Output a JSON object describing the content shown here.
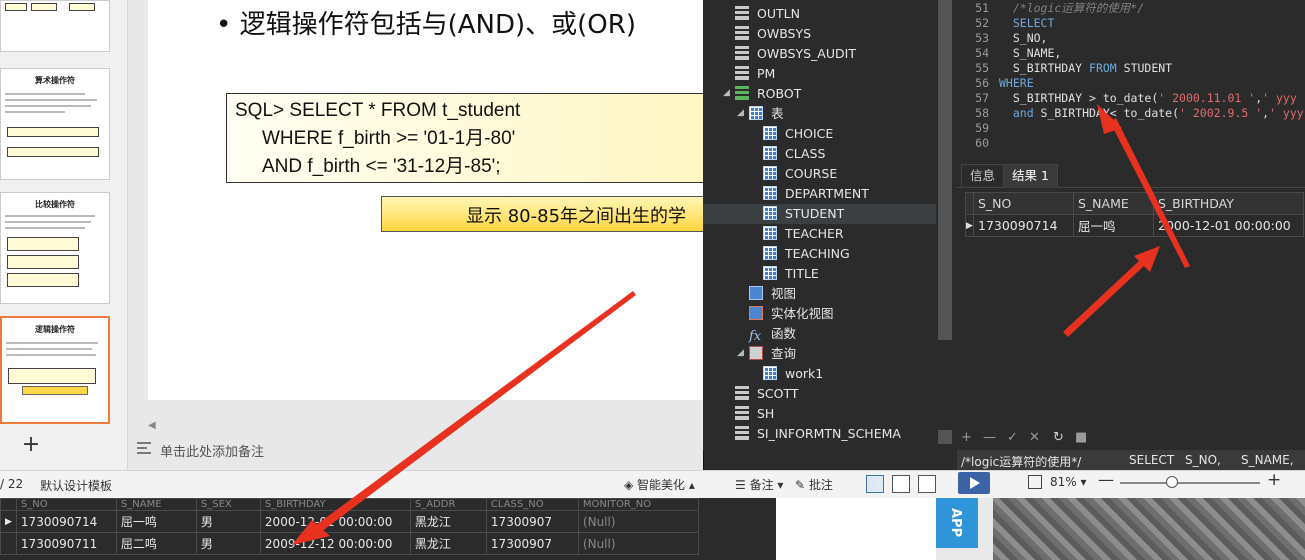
{
  "slide": {
    "bullet": "逻辑操作符包括与(AND)、或(OR)",
    "sql_lines": [
      "SQL> SELECT * FROM t_student",
      "WHERE f_birth >= '01-1月-80'",
      "AND f_birth <= '31-12月-85';"
    ],
    "callout": "显示 80-85年之间出生的学"
  },
  "thumbnails": {
    "titles": [
      "算术操作符",
      "比较操作符",
      "逻辑操作符"
    ]
  },
  "notes_placeholder": "单击此处添加备注",
  "statusbar": {
    "page": "/ 22",
    "template": "默认设计模板",
    "beautify": "智能美化",
    "notes": "备注",
    "comment": "批注",
    "zoom": "81%"
  },
  "bottom_grid": {
    "headers": [
      "S_NO",
      "S_NAME",
      "S_SEX",
      "S_BIRTHDAY",
      "S_ADDR",
      "CLASS_NO",
      "MONITOR_NO"
    ],
    "rows": [
      [
        "1730090714",
        "屈一鸣",
        "男",
        "2000-12-01 00:00:00",
        "黑龙江",
        "17300907",
        "(Null)"
      ],
      [
        "1730090711",
        "屈二鸣",
        "男",
        "2009-12-12 00:00:00",
        "黑龙江",
        "17300907",
        "(Null)"
      ]
    ]
  },
  "app_badge": "APP",
  "tree": {
    "items": [
      "OUTLN",
      "OWBSYS",
      "OWBSYS_AUDIT",
      "PM",
      "ROBOT",
      "表",
      "CHOICE",
      "CLASS",
      "COURSE",
      "DEPARTMENT",
      "STUDENT",
      "TEACHER",
      "TEACHING",
      "TITLE",
      "视图",
      "实体化视图",
      "函数",
      "查询",
      "work1",
      "SCOTT",
      "SH",
      "SI_INFORMTN_SCHEMA"
    ]
  },
  "editor": {
    "lines": [
      {
        "num": "51",
        "parts": [
          [
            "cm",
            "  /*logic运算符的使用*/"
          ]
        ]
      },
      {
        "num": "52",
        "parts": [
          [
            "kw",
            "  SELECT"
          ]
        ]
      },
      {
        "num": "53",
        "parts": [
          [
            "tx",
            "  S_NO,"
          ]
        ]
      },
      {
        "num": "54",
        "parts": [
          [
            "tx",
            "  S_NAME,"
          ]
        ]
      },
      {
        "num": "55",
        "parts": [
          [
            "tx",
            "  S_BIRTHDAY "
          ],
          [
            "kw",
            "FROM"
          ],
          [
            "tx",
            " STUDENT"
          ]
        ]
      },
      {
        "num": "56",
        "parts": [
          [
            "kw",
            "WHERE"
          ]
        ]
      },
      {
        "num": "57",
        "parts": [
          [
            "tx",
            "  S_BIRTHDAY > to_date("
          ],
          [
            "st",
            "' 2000.11.01 '"
          ],
          [
            "tx",
            ","
          ],
          [
            "st",
            "' yyy"
          ]
        ]
      },
      {
        "num": "58",
        "parts": [
          [
            "kw",
            "  and"
          ],
          [
            "tx",
            " S_BIRTHDAY< to_date("
          ],
          [
            "st",
            "' 2002.9.5 '"
          ],
          [
            "tx",
            ","
          ],
          [
            "st",
            "' yyy"
          ]
        ]
      },
      {
        "num": "59",
        "parts": []
      },
      {
        "num": "60",
        "parts": []
      }
    ]
  },
  "result_tabs": [
    "信息",
    "结果 1"
  ],
  "result_grid": {
    "headers": [
      "S_NO",
      "S_NAME",
      "S_BIRTHDAY"
    ],
    "rows": [
      [
        "1730090714",
        "屈一鸣",
        "2000-12-01 00:00:00"
      ]
    ]
  },
  "sql_status": [
    "/*logic运算符的使用*/",
    "SELECT",
    "S_NO,",
    "S_NAME,"
  ],
  "colors": {
    "accent_red": "#e8321f",
    "selected_thumb": "#f07a3c",
    "dark_bg": "#2b2b2b"
  }
}
